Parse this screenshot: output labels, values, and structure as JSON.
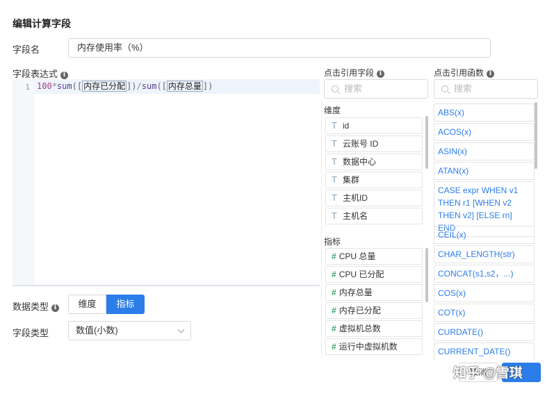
{
  "dialog": {
    "title": "编辑计算字段"
  },
  "field_name": {
    "label": "字段名",
    "value": "内存使用率（%）"
  },
  "expression": {
    "label": "字段表达式",
    "line_number": "1",
    "tokens": {
      "num": "100",
      "op1": "*",
      "fn1": "sum",
      "open1": "([",
      "field1": "内存已分配",
      "close1": "])",
      "op2": "/",
      "fn2": "sum",
      "open2": "([",
      "field2": "内存总量",
      "close2": "])"
    }
  },
  "data_type": {
    "label": "数据类型",
    "options": [
      "维度",
      "指标"
    ],
    "selected": "指标"
  },
  "field_type": {
    "label": "字段类型",
    "value": "数值(小数)"
  },
  "fields_panel": {
    "header": "点击引用字段",
    "search_placeholder": "搜索",
    "dimension_label": "维度",
    "dimensions": [
      "id",
      "云账号 ID",
      "数据中心",
      "集群",
      "主机ID",
      "主机名"
    ],
    "metric_label": "指标",
    "metrics": [
      "CPU 总量",
      "CPU 已分配",
      "内存总量",
      "内存已分配",
      "虚拟机总数",
      "运行中虚拟机数"
    ]
  },
  "functions_panel": {
    "header": "点击引用函数",
    "search_placeholder": "搜索",
    "functions": [
      "ABS(x)",
      "ACOS(x)",
      "ASIN(x)",
      "ATAN(x)",
      "CASE expr WHEN v1 THEN r1 [WHEN v2 THEN v2] [ELSE rn] END",
      "CEIL(x)",
      "CHAR_LENGTH(str)",
      "CONCAT(s1,s2，...)",
      "COS(x)",
      "COT(x)",
      "CURDATE()",
      "CURRENT_DATE()"
    ]
  },
  "footer": {
    "cancel_label": "取消",
    "watermark": "知乎 @雪琪"
  },
  "colors": {
    "accent": "#2b7de9",
    "function_text": "#2b7de9",
    "metric_icon": "#39a36a"
  },
  "icons": {
    "info": "info-circle-icon",
    "search": "search-icon",
    "text_type": "text-type-icon",
    "number_type": "hash-icon",
    "dropdown": "chevron-down-icon"
  }
}
